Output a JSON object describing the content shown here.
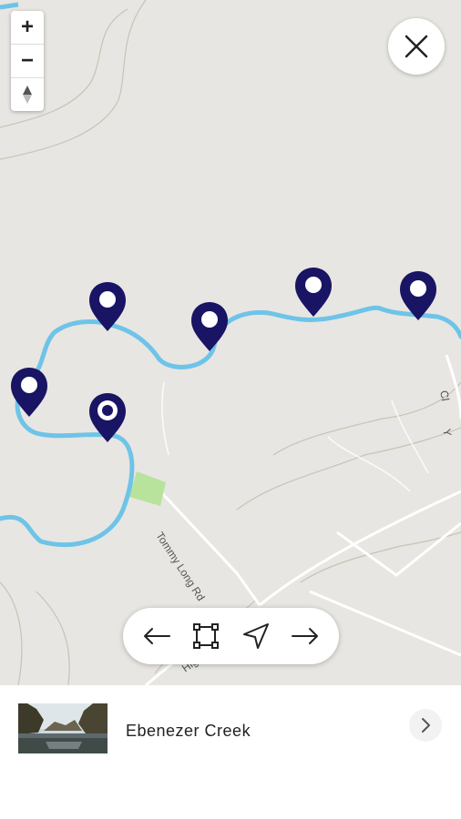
{
  "map": {
    "zoom_in_label": "+",
    "zoom_out_label": "−",
    "compass_icon": "north-arrow-icon",
    "close_icon": "close-icon",
    "road_labels": [
      "Tommy Long Rd",
      "High",
      "Cl",
      "Y"
    ],
    "colors": {
      "water": "#6ec4e8",
      "marker": "#1a1464",
      "park": "#b7e39c",
      "land": "#e8e6e2"
    }
  },
  "toolbar": {
    "prev_icon": "arrow-left-icon",
    "fit_icon": "fit-bounds-icon",
    "locate_icon": "navigation-icon",
    "next_icon": "arrow-right-icon"
  },
  "detail": {
    "place_name": "Ebenezer Creek",
    "chevron_icon": "chevron-right-icon"
  }
}
